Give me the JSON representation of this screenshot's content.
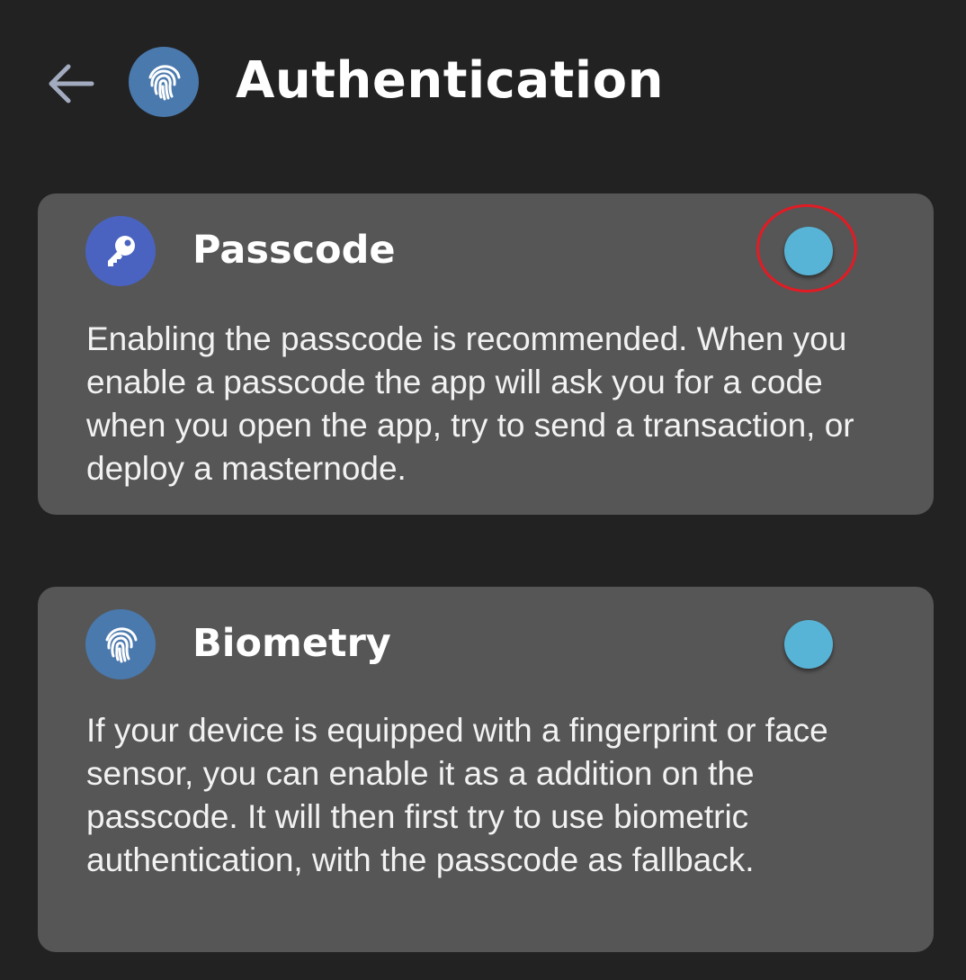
{
  "header": {
    "title": "Authentication",
    "back_icon": "arrow-left-icon",
    "title_icon": "fingerprint-icon"
  },
  "cards": [
    {
      "title": "Passcode",
      "icon": "key-icon",
      "icon_color": "#4a63c0",
      "description": "Enabling the passcode is recommended. When you enable a passcode the app will ask you for a code when you open the app, try to send a transaction, or deploy a masternode.",
      "toggle_color": "#58b4d6",
      "highlighted": true
    },
    {
      "title": "Biometry",
      "icon": "fingerprint-icon",
      "icon_color": "#4a79ad",
      "description": "If your device is equipped with a fingerprint or face sensor, you can enable it as a addition on the passcode. It will then first try to use biometric authentication, with the passcode as fallback.",
      "toggle_color": "#58b4d6",
      "highlighted": false
    }
  ],
  "colors": {
    "background": "#222222",
    "card": "#565656",
    "highlight": "#e21b24"
  }
}
